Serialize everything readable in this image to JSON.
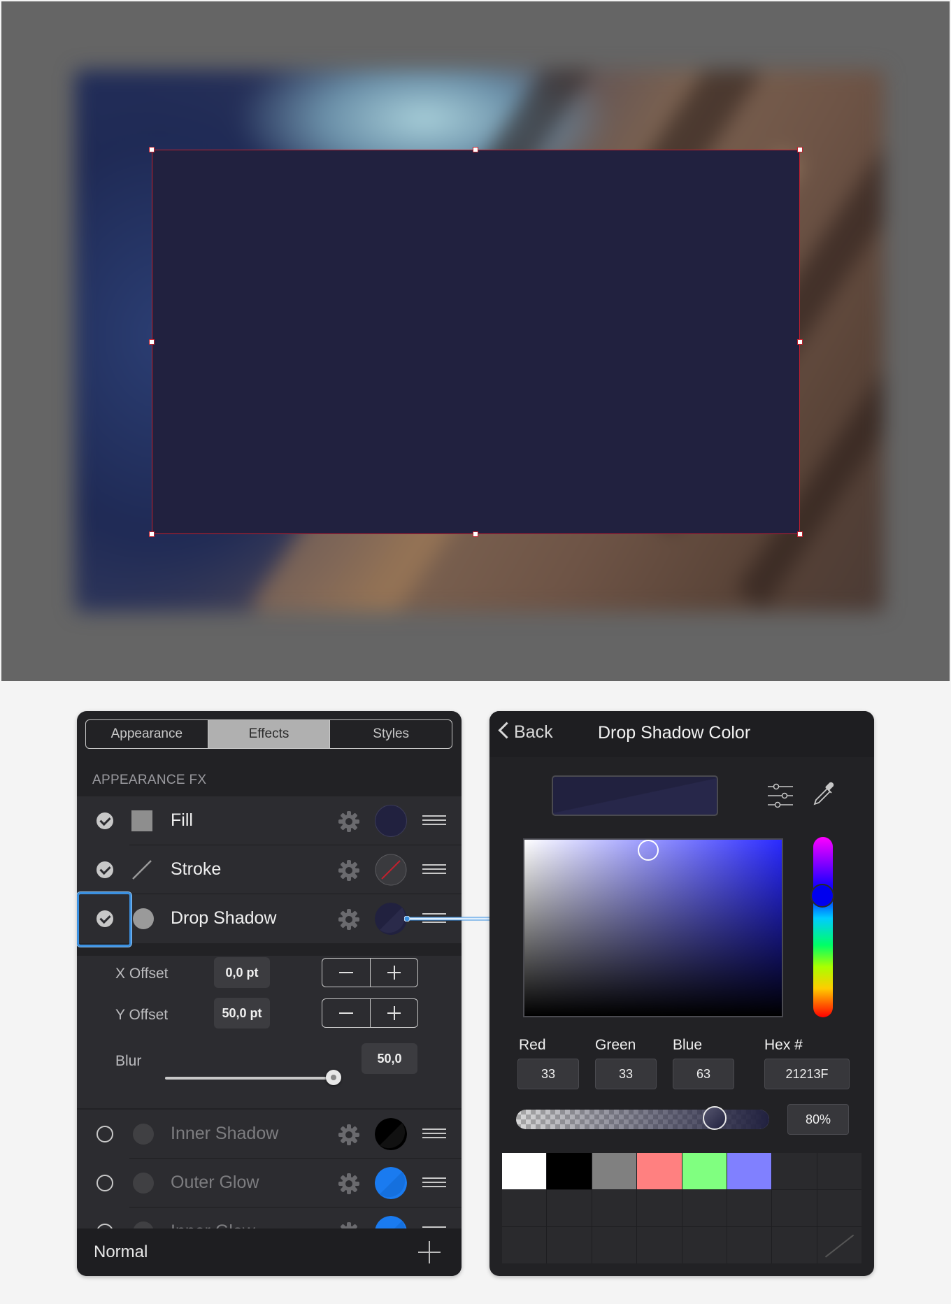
{
  "canvas": {
    "shape_color": "#21213F",
    "selection_color": "#c0202e"
  },
  "left_panel": {
    "tabs": [
      "Appearance",
      "Effects",
      "Styles"
    ],
    "active_tab": "Effects",
    "section_label": "APPEARANCE FX",
    "effects": [
      {
        "label": "Fill",
        "enabled": true,
        "icon": "square-icon",
        "swatch": "#21213F"
      },
      {
        "label": "Stroke",
        "enabled": true,
        "icon": "line-icon",
        "swatch": "none"
      },
      {
        "label": "Drop Shadow",
        "enabled": true,
        "icon": "circle-icon",
        "swatch": "#21213F"
      },
      {
        "label": "Inner Shadow",
        "enabled": false,
        "icon": "circle-icon",
        "swatch": "#000000"
      },
      {
        "label": "Outer Glow",
        "enabled": false,
        "icon": "circle-icon",
        "swatch": "#1a7bf0"
      },
      {
        "label": "Inner Glow",
        "enabled": false,
        "icon": "circle-icon",
        "swatch": "#1a7bf0"
      }
    ],
    "drop_shadow": {
      "x_offset_label": "X Offset",
      "x_offset_value": "0,0 pt",
      "y_offset_label": "Y Offset",
      "y_offset_value": "50,0 pt",
      "blur_label": "Blur",
      "blur_value": "50,0",
      "blur_level": 1.0
    },
    "footer": {
      "blend_mode": "Normal"
    }
  },
  "right_panel": {
    "back_label": "Back",
    "title": "Drop Shadow Color",
    "channels": {
      "red_label": "Red",
      "red_value": "33",
      "green_label": "Green",
      "green_value": "33",
      "blue_label": "Blue",
      "blue_value": "63",
      "hex_label": "Hex #",
      "hex_value": "21213F"
    },
    "opacity": "80%",
    "swatches": [
      "#ffffff",
      "#000000",
      "#808080",
      "#ff8080",
      "#80ff80",
      "#8080ff"
    ]
  }
}
